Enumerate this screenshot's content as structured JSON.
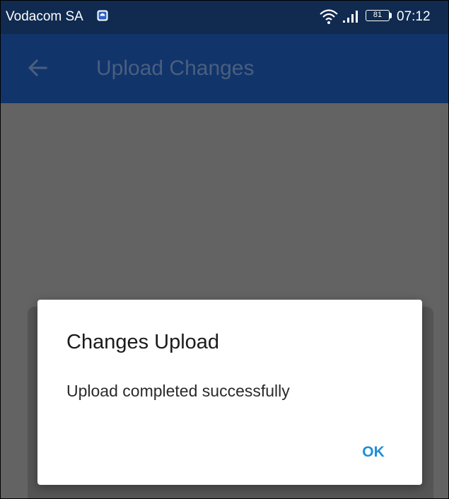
{
  "status_bar": {
    "carrier": "Vodacom SA",
    "battery_level": "81",
    "time": "07:12",
    "icons": [
      "carrier-app-icon",
      "wifi-icon",
      "signal-icon",
      "battery-icon"
    ],
    "background_color": "#102a50"
  },
  "app_bar": {
    "back_icon": "arrow-back-icon",
    "title": "Upload Changes",
    "background_color": "#11346b"
  },
  "dialog": {
    "title": "Changes Upload",
    "message": "Upload completed successfully",
    "ok_label": "OK",
    "accent_color": "#1e8ed6"
  }
}
